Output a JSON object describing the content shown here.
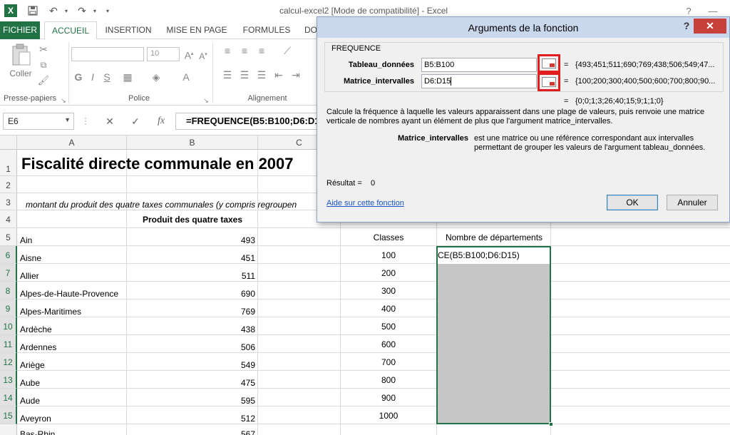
{
  "window": {
    "title": "calcul-excel2  [Mode de compatibilité] - Excel",
    "app_badge": "X",
    "help": "?",
    "minimize": "—",
    "restore": "□"
  },
  "ribbon": {
    "tabs": [
      "FICHIER",
      "ACCUEIL",
      "INSERTION",
      "MISE EN PAGE",
      "FORMULES",
      "DO"
    ],
    "clipboard": {
      "paste_label": "Coller",
      "group_label": "Presse-papiers"
    },
    "font": {
      "size": "10",
      "group_label": "Police"
    },
    "alignment": {
      "group_label": "Alignement"
    }
  },
  "formula_bar": {
    "name_box": "E6",
    "cancel": "✕",
    "enter": "✓",
    "fx": "fx",
    "formula": "=FREQUENCE(B5:B100;D6:D15)"
  },
  "sheet": {
    "columns": [
      "A",
      "B",
      "C"
    ],
    "rows": [
      "1",
      "2",
      "3",
      "4",
      "5",
      "6",
      "7",
      "8",
      "9",
      "10",
      "11",
      "12",
      "13",
      "14",
      "15"
    ],
    "title": "Fiscalité directe communale en 2007",
    "subtitle": "montant du produit des quatre taxes communales (y compris regroupen",
    "header_b": "Produit des quatre taxes",
    "header_classes": "Classes",
    "header_count": "Nombre de départements",
    "departments": [
      "Ain",
      "Aisne",
      "Allier",
      "Alpes-de-Haute-Provence",
      "Alpes-Maritimes",
      "Ardèche",
      "Ardennes",
      "Ariège",
      "Aube",
      "Aude",
      "Aveyron"
    ],
    "values": [
      "493",
      "451",
      "511",
      "690",
      "769",
      "438",
      "506",
      "549",
      "475",
      "595",
      "512"
    ],
    "classes": [
      "100",
      "200",
      "300",
      "400",
      "500",
      "600",
      "700",
      "800",
      "900",
      "1000"
    ],
    "active_cell_text": "CE(B5:B100;D6:D15)",
    "cut_row_dept": "Bas-Rhin",
    "cut_row_value": "567"
  },
  "dialog": {
    "title": "Arguments de la fonction",
    "help_label": "?",
    "close_label": "✕",
    "function_name": "FREQUENCE",
    "arg1_label": "Tableau_données",
    "arg1_value": "B5:B100",
    "arg1_result": "{493;451;511;690;769;438;506;549;47...",
    "arg2_label": "Matrice_intervalles",
    "arg2_value": "D6:D15",
    "arg2_result": "{100;200;300;400;500;600;700;800;90...",
    "equals": "=",
    "formula_result": "{0;0;1;3;26;40;15;9;1;1;0}",
    "description": "Calcule la fréquence à laquelle les valeurs apparaissent dans une plage de valeurs, puis renvoie une matrice verticale de nombres ayant un élément de plus que l'argument matrice_intervalles.",
    "arg_help_label": "Matrice_intervalles",
    "arg_help_text": "est une matrice ou une référence correspondant aux intervalles permettant de grouper les valeurs de l'argument tableau_données.",
    "result_label": "Résultat =",
    "result_value": "0",
    "help_link": "Aide sur cette fonction",
    "ok_label": "OK",
    "cancel_label": "Annuler"
  }
}
